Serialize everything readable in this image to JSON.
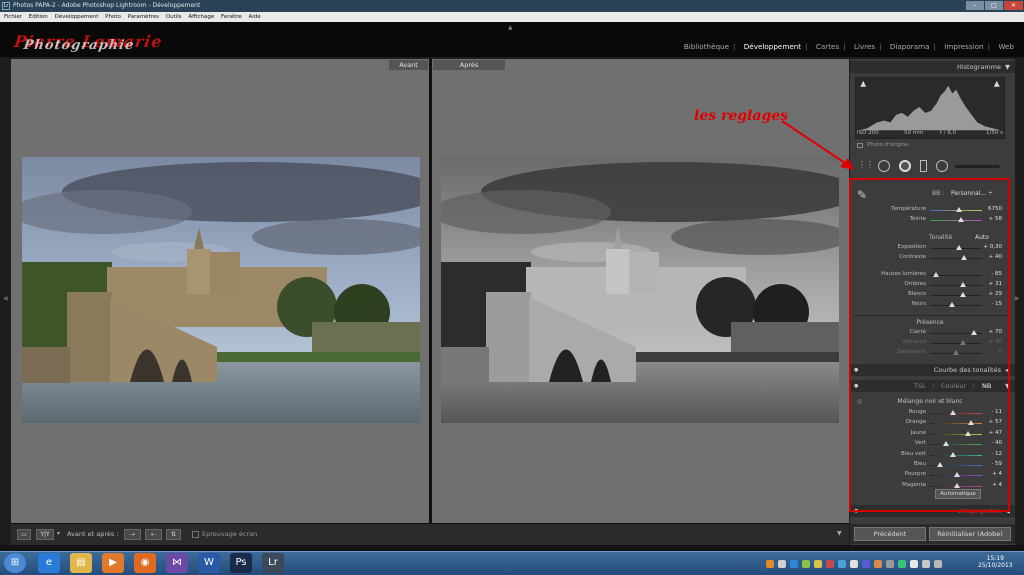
{
  "window": {
    "title": "Photos PAPA-2 - Adobe Photoshop Lightroom - Développement",
    "app_icon": "Lr"
  },
  "menu": [
    "Fichier",
    "Edition",
    "Développement",
    "Photo",
    "Paramètres",
    "Outils",
    "Affichage",
    "Fenêtre",
    "Aide"
  ],
  "identity": {
    "line1": "Pierre Lemarie",
    "line2": "Photographie"
  },
  "modules": [
    {
      "label": "Bibliothèque",
      "active": false
    },
    {
      "label": "Développement",
      "active": true
    },
    {
      "label": "Cartes",
      "active": false
    },
    {
      "label": "Livres",
      "active": false
    },
    {
      "label": "Diaporama",
      "active": false
    },
    {
      "label": "Impression",
      "active": false
    },
    {
      "label": "Web",
      "active": false
    }
  ],
  "view": {
    "before_label": "Avant",
    "after_label": "Après"
  },
  "toolbar": {
    "mode1": "▭",
    "mode2": "Y|Y",
    "mode_arrow": "▾",
    "before_after_label": "Avant et après :",
    "softproof_label": "Epreuvage écran"
  },
  "histogram": {
    "title": "Histogramme",
    "iso": "ISO 200",
    "focal": "50 mm",
    "aperture": "f / 8,0",
    "shutter": "1/50 s",
    "original_photo": "Photo d'origine"
  },
  "basic": {
    "wb_label": "BB :",
    "wb_value": "Personnal... ÷",
    "tone_label": "Tonalité",
    "auto_label": "Auto",
    "presence_label": "Présence",
    "sliders": [
      {
        "label": "Température",
        "value": "6750",
        "pos": 0.56,
        "dim": false
      },
      {
        "label": "Teinte",
        "value": "+ 58",
        "pos": 0.6,
        "dim": false
      },
      {
        "label": "Exposition",
        "value": "+ 0,30",
        "pos": 0.55,
        "dim": false
      },
      {
        "label": "Contraste",
        "value": "+ 40",
        "pos": 0.65,
        "dim": false
      },
      {
        "label": "Hautes lumières",
        "value": "- 85",
        "pos": 0.12,
        "dim": false
      },
      {
        "label": "Ombres",
        "value": "+ 31",
        "pos": 0.64,
        "dim": false
      },
      {
        "label": "Blancs",
        "value": "+ 29",
        "pos": 0.64,
        "dim": false
      },
      {
        "label": "Noirs",
        "value": "- 15",
        "pos": 0.42,
        "dim": false
      },
      {
        "label": "Clarté",
        "value": "+ 70",
        "pos": 0.84,
        "dim": false
      },
      {
        "label": "Vibrance",
        "value": "+ 30",
        "pos": 0.64,
        "dim": true
      },
      {
        "label": "Saturation",
        "value": "0",
        "pos": 0.5,
        "dim": true
      }
    ]
  },
  "tone_curve": {
    "title": "Courbe des tonalités"
  },
  "hsl": {
    "tabs": [
      "TSL",
      "Couleur",
      "NB"
    ],
    "active_tab": "NB",
    "section_label": "Mélange noir et blanc",
    "auto_button": "Automatique",
    "sliders": [
      {
        "label": "Rouge",
        "value": "- 11",
        "pos": 0.44,
        "color": "#c94040"
      },
      {
        "label": "Orange",
        "value": "+ 57",
        "pos": 0.78,
        "color": "#d48a3a"
      },
      {
        "label": "Jaune",
        "value": "+ 47",
        "pos": 0.73,
        "color": "#cbbd3c"
      },
      {
        "label": "Vert",
        "value": "- 40",
        "pos": 0.3,
        "color": "#4faa4a"
      },
      {
        "label": "Bleu vert",
        "value": "- 12",
        "pos": 0.44,
        "color": "#3bb0a8"
      },
      {
        "label": "Bleu",
        "value": "- 59",
        "pos": 0.2,
        "color": "#4070cc"
      },
      {
        "label": "Pourpre",
        "value": "+ 4",
        "pos": 0.52,
        "color": "#8a52c2"
      },
      {
        "label": "Magenta",
        "value": "+ 4",
        "pos": 0.52,
        "color": "#c8469a"
      }
    ]
  },
  "split_toning": {
    "title": "Virage partiel"
  },
  "annotation": "les reglages",
  "panel_buttons": {
    "previous": "Précédent",
    "reset": "Réinitialiser (Adobe)"
  },
  "clock": {
    "time": "15:19",
    "date": "25/10/2013"
  },
  "taskbar_icons": [
    {
      "name": "start",
      "glyph": "⊞",
      "color": "#4a8ad4"
    },
    {
      "name": "ie",
      "glyph": "e",
      "color": "#2a7bd8"
    },
    {
      "name": "explorer",
      "glyph": "▤",
      "color": "#e2b64a"
    },
    {
      "name": "media",
      "glyph": "▶",
      "color": "#e07a2a"
    },
    {
      "name": "firefox",
      "glyph": "◉",
      "color": "#e06a20"
    },
    {
      "name": "vs",
      "glyph": "⋈",
      "color": "#6a4aa6"
    },
    {
      "name": "word",
      "glyph": "W",
      "color": "#2a5aa6"
    },
    {
      "name": "photoshop",
      "glyph": "Ps",
      "color": "#1a2a4a"
    },
    {
      "name": "lightroom",
      "glyph": "Lr",
      "color": "#3a4a5a"
    }
  ]
}
